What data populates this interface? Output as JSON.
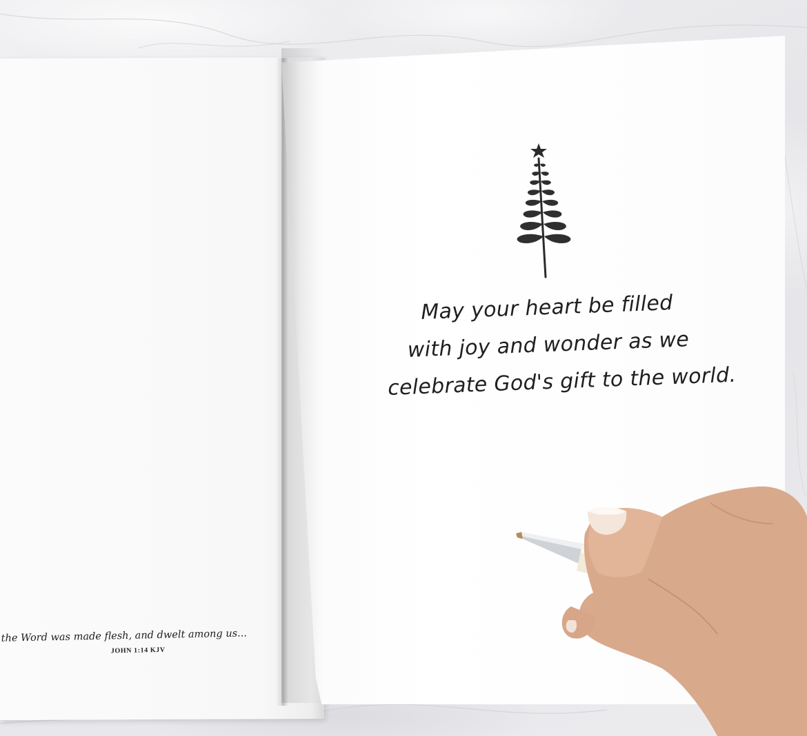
{
  "image": {
    "type": "photo",
    "subject": "open greeting card"
  },
  "card": {
    "inside_message_lines": [
      "May your heart be filled",
      "with joy and wonder as we",
      "celebrate God's gift to the world."
    ],
    "verse_text": "the Word was made flesh, and dwelt among us...",
    "verse_reference": "JOHN 1:14 KJV",
    "tree_icon": "christmas-tree-with-star-icon"
  },
  "colors": {
    "ink": "#1f1f1f",
    "paper": "#ffffff",
    "marble": "#e9e9ec",
    "pen_barrel": "#f1ebd8",
    "pen_metal": "#c9ccd1"
  }
}
